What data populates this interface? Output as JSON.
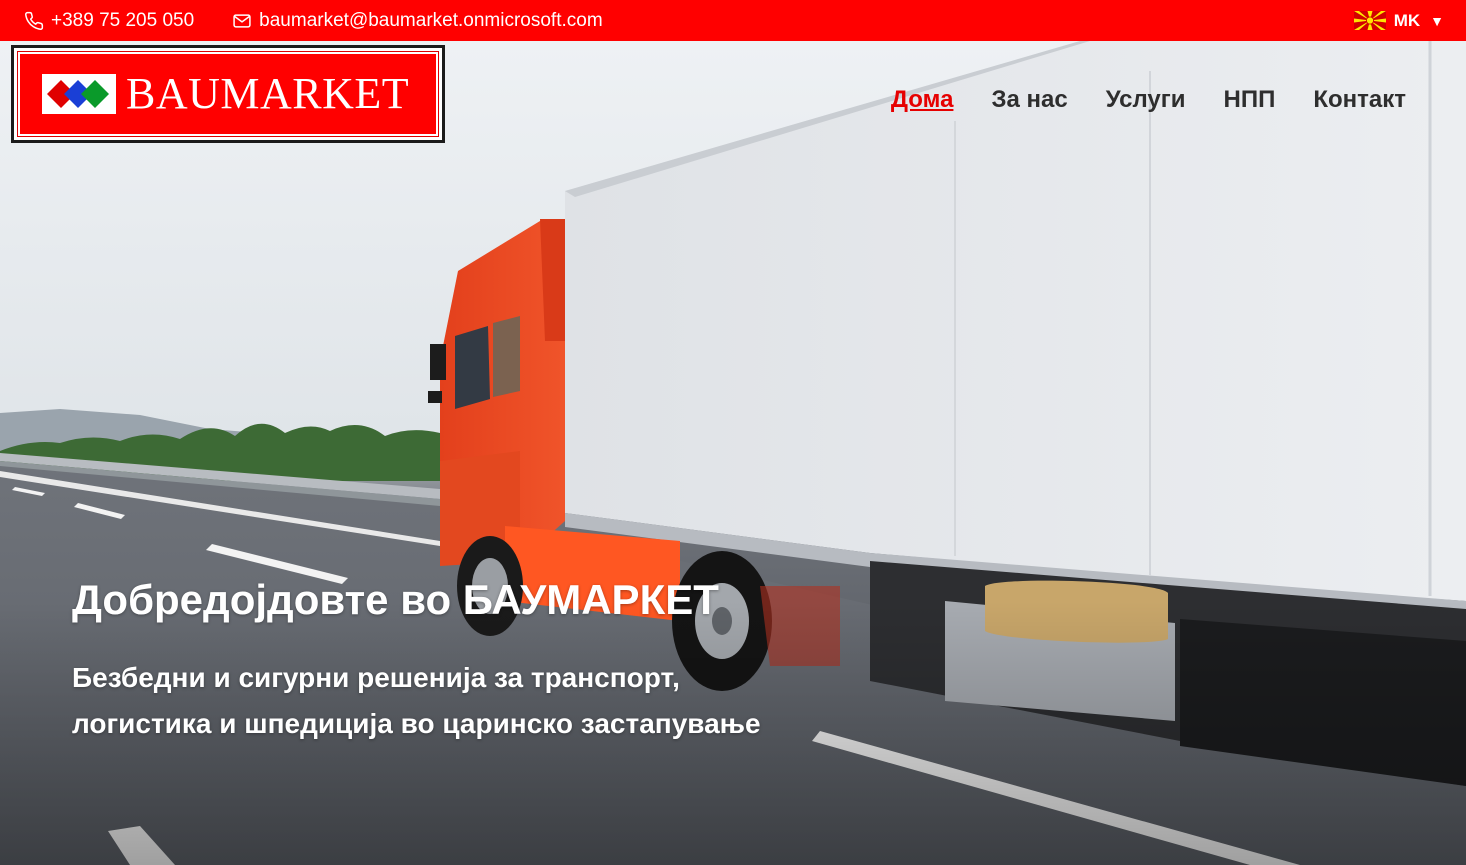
{
  "topbar": {
    "phone": "+389 75 205 050",
    "email": "baumarket@baumarket.onmicrosoft.com",
    "language": "MK",
    "language_caret": "▼",
    "icons": {
      "phone": "phone-icon",
      "email": "envelope-icon",
      "flag": "macedonia-flag-icon"
    },
    "colors": {
      "background": "#ff0000",
      "text": "#ffffff"
    }
  },
  "logo": {
    "text": "BAUMARKET",
    "colors": {
      "background": "#ff0000",
      "diamonds": [
        "#e00000",
        "#1a3fd6",
        "#0a9a2a"
      ]
    }
  },
  "nav": {
    "items": [
      {
        "label": "Дома",
        "active": true
      },
      {
        "label": "За нас",
        "active": false
      },
      {
        "label": "Услуги",
        "active": false
      },
      {
        "label": "НПП",
        "active": false
      },
      {
        "label": "Контакт",
        "active": false
      }
    ],
    "colors": {
      "active": "#e60000",
      "default": "#2e2e2e"
    }
  },
  "hero": {
    "title": "Добредојдовте во БАУМАРКЕТ",
    "subtitle_line1": "Безбедни и сигурни решенија за транспорт,",
    "subtitle_line2": "логистика и шпедиција во царинско застапување",
    "image": "orange-truck-with-white-trailer-on-highway"
  }
}
